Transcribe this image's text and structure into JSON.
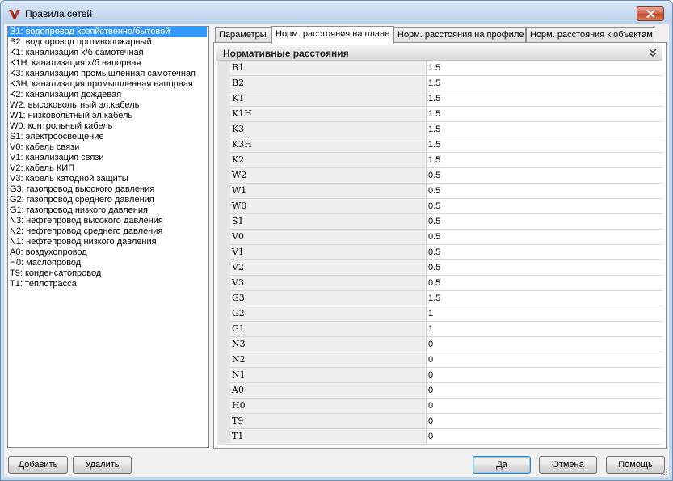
{
  "window": {
    "title": "Правила сетей"
  },
  "networks": [
    {
      "label": "B1: водопровод хозяйственно/бытовой",
      "selected": true
    },
    {
      "label": "B2: водопровод противопожарный"
    },
    {
      "label": "K1: канализация х/б самотечная"
    },
    {
      "label": "K1H: канализация х/б напорная"
    },
    {
      "label": "K3: канализация промышленная самотечная"
    },
    {
      "label": "K3H: канализация промышленная напорная"
    },
    {
      "label": "K2: канализация дождевая"
    },
    {
      "label": "W2: высоковольтный эл.кабель"
    },
    {
      "label": "W1: низковольтный эл.кабель"
    },
    {
      "label": "W0: контрольный кабель"
    },
    {
      "label": "S1: электроосвещение"
    },
    {
      "label": "V0: кабель связи"
    },
    {
      "label": "V1: канализация связи"
    },
    {
      "label": "V2: кабель КИП"
    },
    {
      "label": "V3: кабель катодной защиты"
    },
    {
      "label": "G3: газопровод высокого давления"
    },
    {
      "label": "G2: газопровод среднего давления"
    },
    {
      "label": "G1: газопровод низкого давления"
    },
    {
      "label": "N3: нефтепровод высокого давления"
    },
    {
      "label": "N2: нефтепровод среднего давления"
    },
    {
      "label": "N1: нефтепровод низкого давления"
    },
    {
      "label": "A0: воздухопровод"
    },
    {
      "label": "H0: маслопровод"
    },
    {
      "label": "T9: конденсатопровод"
    },
    {
      "label": "T1: теплотрасса"
    }
  ],
  "tabs": [
    {
      "label": "Параметры"
    },
    {
      "label": "Норм. расстояния на плане",
      "active": true
    },
    {
      "label": "Норм. расстояния на профиле"
    },
    {
      "label": "Норм. расстояния к объектам"
    }
  ],
  "group": {
    "title": "Нормативные расстояния"
  },
  "distances": [
    {
      "key": "B1",
      "value": "1.5"
    },
    {
      "key": "B2",
      "value": "1.5"
    },
    {
      "key": "K1",
      "value": "1.5"
    },
    {
      "key": "K1H",
      "value": "1.5"
    },
    {
      "key": "K3",
      "value": "1.5"
    },
    {
      "key": "K3H",
      "value": "1.5"
    },
    {
      "key": "K2",
      "value": "1.5"
    },
    {
      "key": "W2",
      "value": "0.5"
    },
    {
      "key": "W1",
      "value": "0.5"
    },
    {
      "key": "W0",
      "value": "0.5"
    },
    {
      "key": "S1",
      "value": "0.5"
    },
    {
      "key": "V0",
      "value": "0.5"
    },
    {
      "key": "V1",
      "value": "0.5"
    },
    {
      "key": "V2",
      "value": "0.5"
    },
    {
      "key": "V3",
      "value": "0.5"
    },
    {
      "key": "G3",
      "value": "1.5"
    },
    {
      "key": "G2",
      "value": "1"
    },
    {
      "key": "G1",
      "value": "1"
    },
    {
      "key": "N3",
      "value": "0"
    },
    {
      "key": "N2",
      "value": "0"
    },
    {
      "key": "N1",
      "value": "0"
    },
    {
      "key": "A0",
      "value": "0"
    },
    {
      "key": "H0",
      "value": "0"
    },
    {
      "key": "T9",
      "value": "0"
    },
    {
      "key": "T1",
      "value": "0"
    }
  ],
  "buttons": {
    "add": "Добавить",
    "delete": "Удалить",
    "ok": "Да",
    "cancel": "Отмена",
    "help": "Помощь"
  },
  "colors": {
    "selection": "#3399ff",
    "close_button": "#c75050",
    "app_icon": "#c0392b"
  }
}
